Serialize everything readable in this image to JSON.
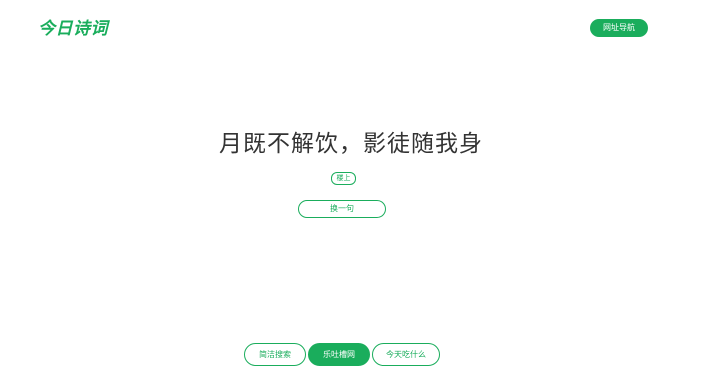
{
  "header": {
    "logo_text": "今日诗词",
    "nav_button_label": "网址导航"
  },
  "poem": {
    "line": "月既不解饮，影徒随我身",
    "source_tag": "楼上",
    "refresh_label": "换一句"
  },
  "footer": {
    "links": [
      {
        "label": "简洁搜索"
      },
      {
        "label": "乐吐槽网"
      },
      {
        "label": "今天吃什么"
      }
    ]
  },
  "colors": {
    "accent": "#1aad5c",
    "text": "#333333",
    "background": "#ffffff"
  }
}
